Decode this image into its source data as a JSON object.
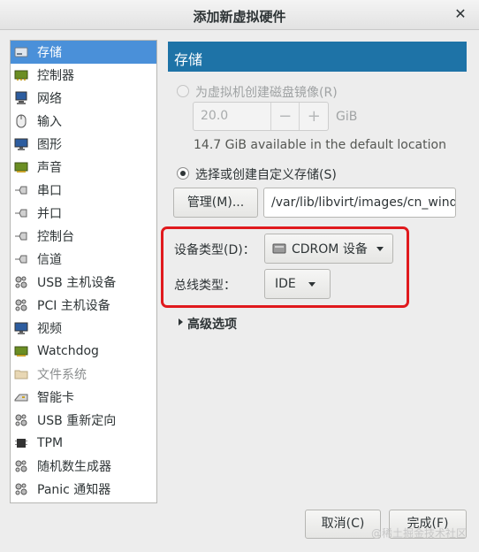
{
  "window": {
    "title": "添加新虚拟硬件"
  },
  "sidebar": {
    "items": [
      {
        "label": "存储",
        "icon": "storage-icon"
      },
      {
        "label": "控制器",
        "icon": "controller-icon"
      },
      {
        "label": "网络",
        "icon": "network-icon"
      },
      {
        "label": "输入",
        "icon": "mouse-icon"
      },
      {
        "label": "图形",
        "icon": "display-icon"
      },
      {
        "label": "声音",
        "icon": "sound-card-icon"
      },
      {
        "label": "串口",
        "icon": "serial-plug-icon"
      },
      {
        "label": "并口",
        "icon": "parallel-plug-icon"
      },
      {
        "label": "控制台",
        "icon": "console-plug-icon"
      },
      {
        "label": "信道",
        "icon": "channel-plug-icon"
      },
      {
        "label": "USB 主机设备",
        "icon": "usb-device-icon"
      },
      {
        "label": "PCI 主机设备",
        "icon": "pci-device-icon"
      },
      {
        "label": "视频",
        "icon": "video-icon"
      },
      {
        "label": "Watchdog",
        "icon": "watchdog-icon"
      },
      {
        "label": "文件系统",
        "icon": "folder-icon"
      },
      {
        "label": "智能卡",
        "icon": "smartcard-icon"
      },
      {
        "label": "USB 重新定向",
        "icon": "usb-redirect-icon"
      },
      {
        "label": "TPM",
        "icon": "tpm-icon"
      },
      {
        "label": "随机数生成器",
        "icon": "rng-icon"
      },
      {
        "label": "Panic 通知器",
        "icon": "panic-notifier-icon"
      }
    ]
  },
  "main": {
    "header": "存储",
    "create_image_label": "为虚拟机创建磁盘镜像(R)",
    "size_value": "20.0",
    "size_unit": "GiB",
    "minus": "−",
    "plus": "+",
    "available_text": "14.7 GiB available in the default location",
    "custom_storage_label": "选择或创建自定义存储(S)",
    "manage_button": "管理(M)...",
    "path_value": "/var/lib/libvirt/images/cn_windo",
    "device_type_label": "设备类型(D)：",
    "device_type_value": "CDROM 设备",
    "bus_type_label": "总线类型：",
    "bus_type_value": "IDE",
    "advanced_label": "高级选项"
  },
  "footer": {
    "cancel": "取消(C)",
    "finish": "完成(F)",
    "watermark": "@稀土掘金技术社区"
  },
  "colors": {
    "selection": "#4a90d9",
    "header_bar": "#1e73a7",
    "highlight_box": "#e0191d"
  }
}
